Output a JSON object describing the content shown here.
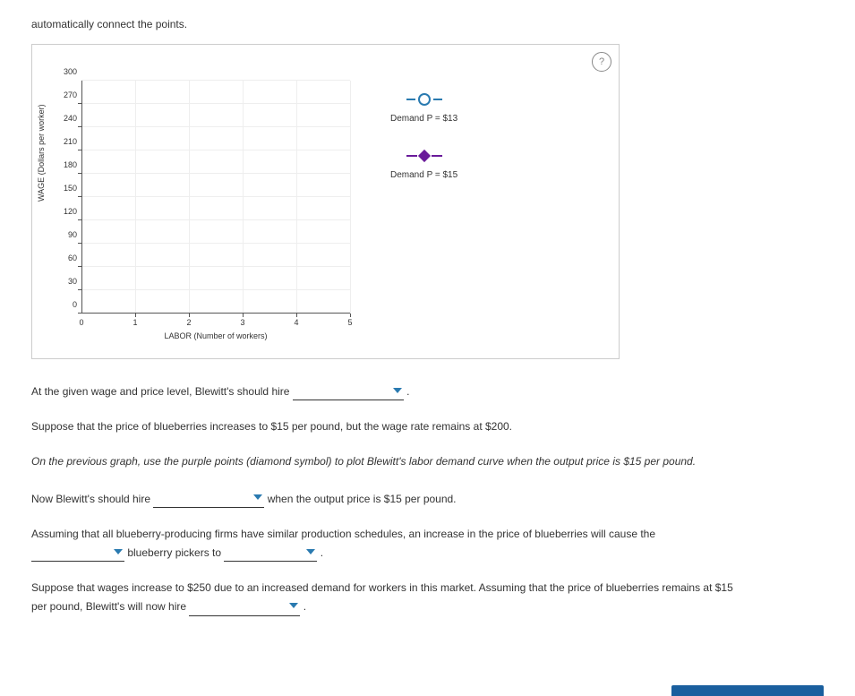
{
  "intro_text": "automatically connect the points.",
  "help_icon": "?",
  "chart_data": {
    "type": "scatter",
    "title": "",
    "xlabel": "LABOR (Number of workers)",
    "ylabel": "WAGE (Dollars per worker)",
    "x_ticks": [
      0,
      1,
      2,
      3,
      4,
      5
    ],
    "y_ticks": [
      0,
      30,
      60,
      90,
      120,
      150,
      180,
      210,
      240,
      270,
      300
    ],
    "xlim": [
      0,
      5
    ],
    "ylim": [
      0,
      300
    ],
    "series": [
      {
        "name": "Demand P = $13",
        "symbol": "circle",
        "color": "#2a7ab0",
        "values": []
      },
      {
        "name": "Demand P = $15",
        "symbol": "diamond",
        "color": "#6a1b9a",
        "values": []
      }
    ]
  },
  "legend": {
    "item1": "Demand P = $13",
    "item2": "Demand P = $15"
  },
  "q1": {
    "prefix": "At the given wage and price level, Blewitt's should hire",
    "suffix": "."
  },
  "q2": "Suppose that the price of blueberries increases to $15 per pound, but the wage rate remains at $200.",
  "q3": "On the previous graph, use the purple points (diamond symbol) to plot Blewitt's labor demand curve when the output price is $15 per pound.",
  "q4": {
    "prefix": "Now Blewitt's should hire",
    "suffix": "when the output price is $15 per pound."
  },
  "q5": {
    "prefix": "Assuming that all blueberry-producing firms have similar production schedules, an increase in the price of blueberries will cause the",
    "mid": "blueberry pickers to",
    "suffix": "."
  },
  "q6": {
    "line1": "Suppose that wages increase to $250 due to an increased demand for workers in this market. Assuming that the price of blueberries remains at $15",
    "line2_prefix": "per pound, Blewitt's will now hire",
    "suffix": "."
  }
}
